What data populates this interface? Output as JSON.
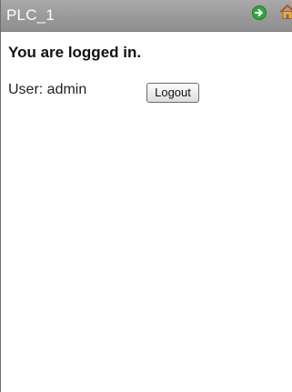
{
  "titlebar": {
    "title": "PLC_1",
    "forward_icon": "arrow-right-circle-icon",
    "home_icon": "home-icon",
    "forward_color": "#2fa83a",
    "home_color": "#e6a421"
  },
  "main": {
    "heading": "You are logged in.",
    "user_text": "User: admin",
    "logout_label": "Logout"
  }
}
